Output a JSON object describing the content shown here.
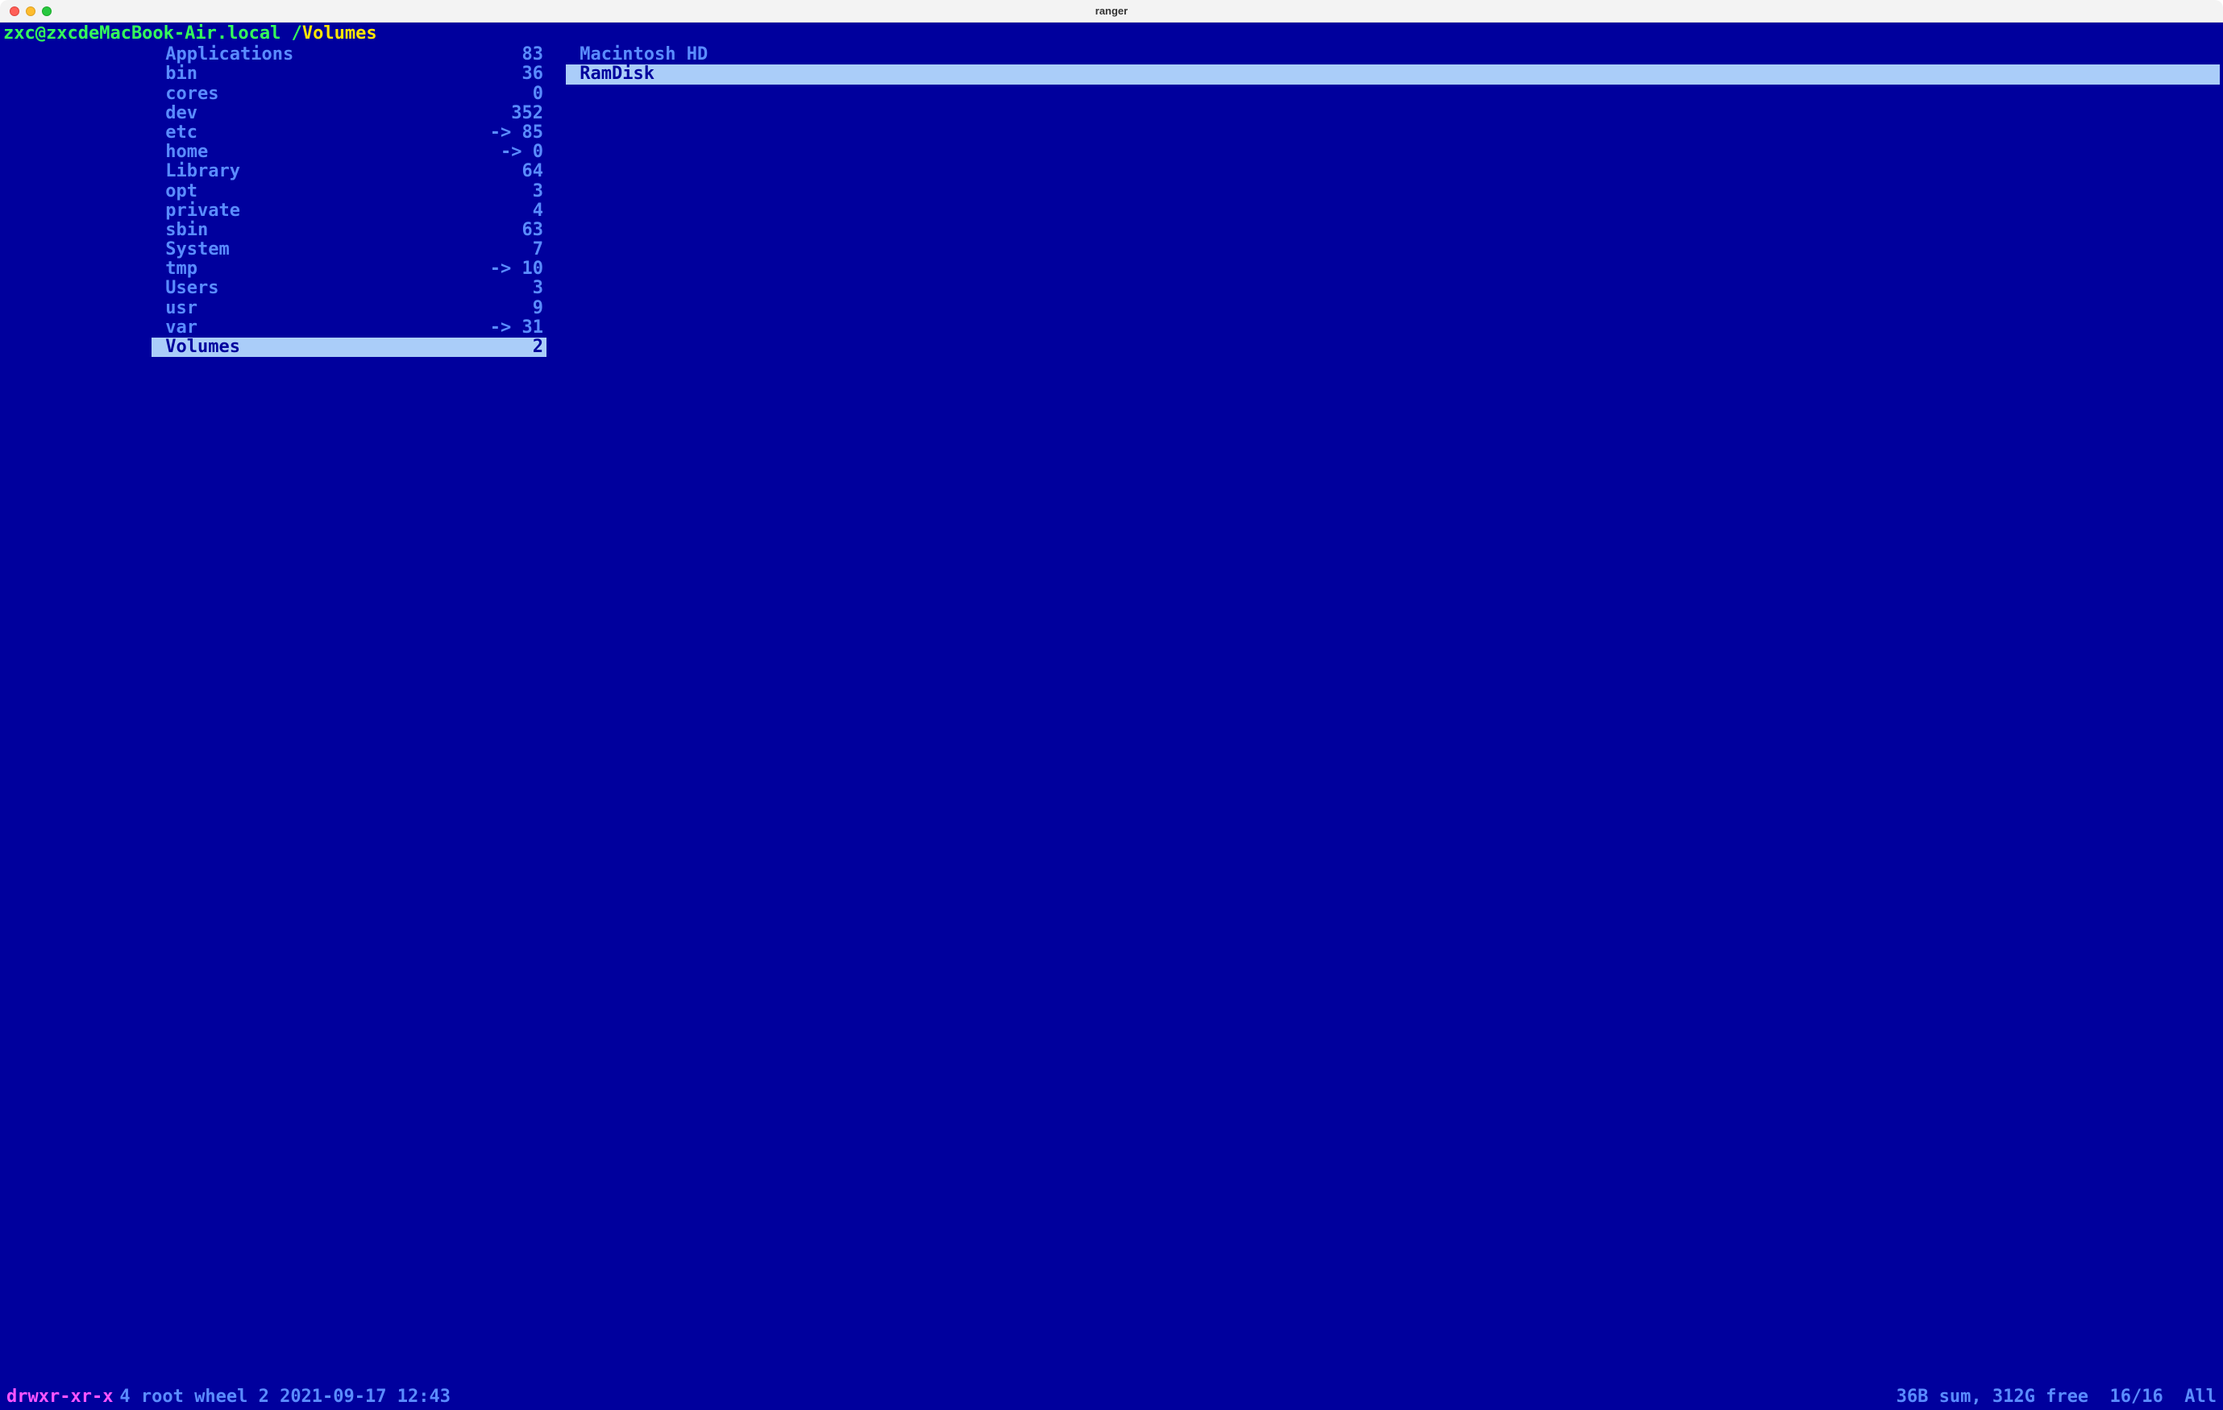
{
  "window": {
    "title": "ranger"
  },
  "header": {
    "user_host": "zxc@zxcdeMacBook-Air.local",
    "path_prefix": "/",
    "path_current": "Volumes"
  },
  "middle_column": {
    "items": [
      {
        "name": "Applications",
        "count": "83",
        "link": false,
        "selected": false
      },
      {
        "name": "bin",
        "count": "36",
        "link": false,
        "selected": false
      },
      {
        "name": "cores",
        "count": "0",
        "link": false,
        "selected": false
      },
      {
        "name": "dev",
        "count": "352",
        "link": false,
        "selected": false
      },
      {
        "name": "etc",
        "count": "85",
        "link": true,
        "selected": false
      },
      {
        "name": "home",
        "count": "0",
        "link": true,
        "selected": false
      },
      {
        "name": "Library",
        "count": "64",
        "link": false,
        "selected": false
      },
      {
        "name": "opt",
        "count": "3",
        "link": false,
        "selected": false
      },
      {
        "name": "private",
        "count": "4",
        "link": false,
        "selected": false
      },
      {
        "name": "sbin",
        "count": "63",
        "link": false,
        "selected": false
      },
      {
        "name": "System",
        "count": "7",
        "link": false,
        "selected": false
      },
      {
        "name": "tmp",
        "count": "10",
        "link": true,
        "selected": false
      },
      {
        "name": "Users",
        "count": "3",
        "link": false,
        "selected": false
      },
      {
        "name": "usr",
        "count": "9",
        "link": false,
        "selected": false
      },
      {
        "name": "var",
        "count": "31",
        "link": true,
        "selected": false
      },
      {
        "name": "Volumes",
        "count": "2",
        "link": false,
        "selected": true
      }
    ]
  },
  "preview_column": {
    "items": [
      {
        "name": "Macintosh HD",
        "selected": false
      },
      {
        "name": "RamDisk",
        "selected": true
      }
    ]
  },
  "status": {
    "perms": "drwxr-xr-x",
    "details": "4 root wheel 2 2021-09-17 12:43",
    "right": "36B sum, 312G free  16/16  All"
  }
}
